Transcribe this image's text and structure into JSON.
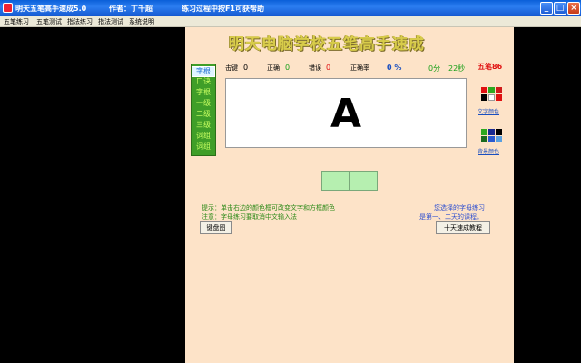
{
  "window": {
    "title": "明天五笔高手速成5.0",
    "author": "作者：丁千超",
    "help_hint": "练习过程中按F1可获帮助",
    "min": "_",
    "max": "□",
    "close": "×"
  },
  "menu": [
    "五笔练习",
    "五笔测试",
    "指法练习",
    "指法测试",
    "系统说明"
  ],
  "brand": "明天电脑学校五笔高手速成",
  "practice_menu": [
    "字根",
    "口诀",
    "字根",
    "一级",
    "二级",
    "三级",
    "词组",
    "词组"
  ],
  "stats": {
    "hits_label": "击键",
    "hits_value": "0",
    "correct_label": "正确",
    "correct_value": "0",
    "errors_label": "错误",
    "errors_value": "0",
    "rate_label": "正确率",
    "rate_value": "0 %",
    "minutes": "0分",
    "seconds": "22秒"
  },
  "current_char": "A",
  "wubi_mode": "五笔86",
  "text_color_label": "文字颜色",
  "bg_color_label": "背景颜色",
  "tip_line1": "提示：单击右边的颜色框可改变文字和方框颜色",
  "tip_line2": "注意：字母练习要取消中文输入法",
  "note_line1": "您选择的字母练习",
  "note_line2": "是第一、二天的课程。",
  "keyboard_button": "键盘图",
  "course_button": "十天速成教程",
  "colors": {
    "panel_bg": "#fde3c8",
    "menu_green": "#3f9e28",
    "input_green": "#b6efb0",
    "accent_red": "#e01010"
  }
}
